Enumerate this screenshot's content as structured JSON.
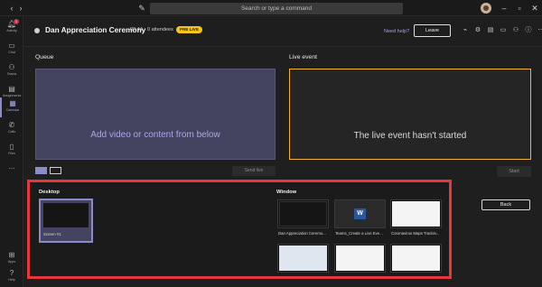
{
  "topbar": {
    "search_placeholder": "Search or type a command",
    "avatar_badge": "●"
  },
  "rail": {
    "items": [
      {
        "label": "Activity",
        "icon": "bell-icon",
        "badge": "1"
      },
      {
        "label": "Chat",
        "icon": "chat-icon"
      },
      {
        "label": "Teams",
        "icon": "teams-icon"
      },
      {
        "label": "Assignments",
        "icon": "assignments-icon"
      },
      {
        "label": "Calendar",
        "icon": "calendar-icon",
        "active": true
      },
      {
        "label": "Calls",
        "icon": "phone-icon"
      },
      {
        "label": "Files",
        "icon": "file-icon"
      },
      {
        "label": "...",
        "icon": "more-icon"
      },
      {
        "label": "Apps",
        "icon": "apps-icon"
      },
      {
        "label": "Help",
        "icon": "help-icon"
      }
    ]
  },
  "header": {
    "event_title": "Dan Appreciation Ceremony",
    "time": "09:44",
    "attendees": "0 attendees",
    "status_badge": "PRE LIVE",
    "need_help": "Need help?",
    "leave_label": "Leave"
  },
  "queue": {
    "label": "Queue",
    "placeholder": "Add video or content from below",
    "send_live_label": "Send live"
  },
  "live_event": {
    "label": "Live event",
    "message": "The live event hasn't started",
    "start_label": "Start"
  },
  "share_panel": {
    "desktop_label": "Desktop",
    "window_label": "Window",
    "screens": [
      {
        "caption": "Screen #1"
      }
    ],
    "windows": [
      {
        "caption": "Dan Appreciation Ceremo..."
      },
      {
        "caption": "Teams_Create a Live Eve..."
      },
      {
        "caption": "Coronavirus Maps Trackin..."
      },
      {
        "caption": ""
      },
      {
        "caption": ""
      },
      {
        "caption": ""
      }
    ],
    "back_label": "Back"
  },
  "colors": {
    "accent": "#8b8cc7",
    "highlight_border": "#e6373d",
    "live_border": "#f0b429",
    "prelive": "#f5c518"
  }
}
